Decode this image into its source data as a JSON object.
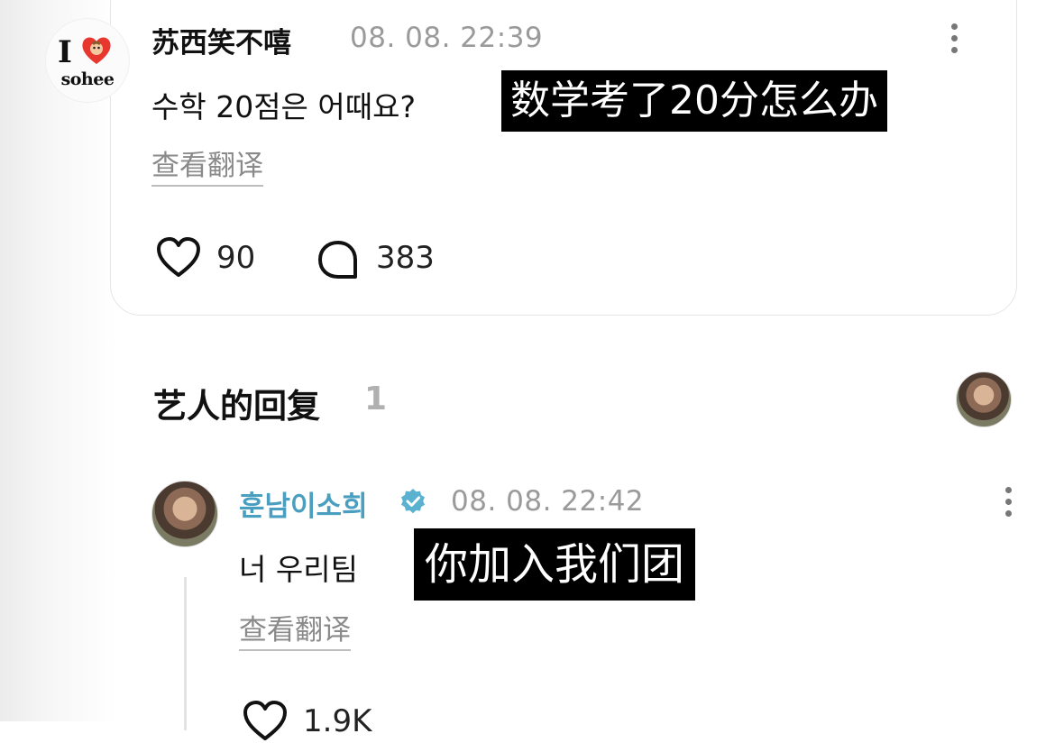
{
  "post": {
    "logo_letter": "I",
    "logo_text": "sohee",
    "username": "苏西笑不嘻",
    "timestamp": "08. 08. 22:39",
    "comment": "수학 20점은 어때요?",
    "subtitle": "数学考了20分怎么办",
    "translate_label": "查看翻译",
    "likes": "90",
    "replies": "383"
  },
  "artist_section": {
    "title": "艺人的回复",
    "count": "1"
  },
  "reply": {
    "username": "훈남이소희",
    "timestamp": "08. 08. 22:42",
    "comment": "너 우리팀",
    "subtitle": "你加入我们团",
    "translate_label": "查看翻译",
    "likes": "1.9K"
  },
  "colors": {
    "artist_name": "#4a9fc0",
    "verified_badge": "#5ab2d0",
    "timestamp": "#9a9a9a",
    "subtitle_bg": "#000000"
  },
  "icons": [
    "heart-icon",
    "comment-bubble-icon",
    "more-options-icon",
    "verified-badge-icon",
    "avatar"
  ]
}
